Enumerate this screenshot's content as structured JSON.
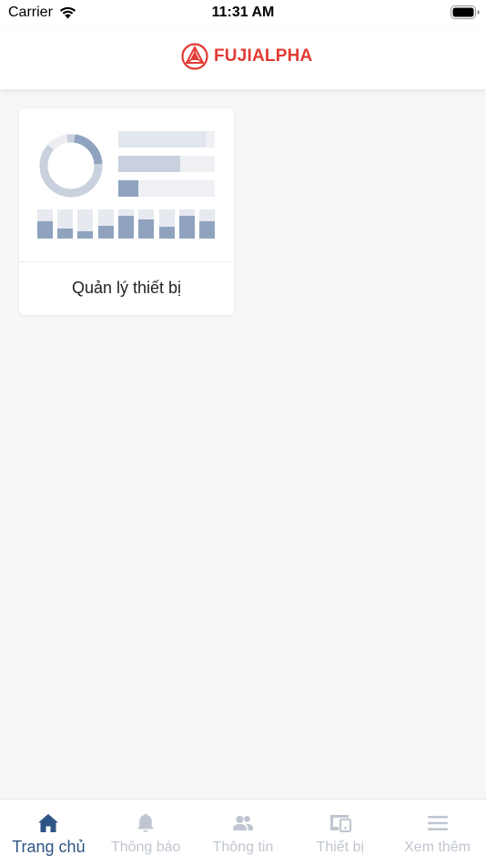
{
  "status_bar": {
    "carrier": "Carrier",
    "time": "11:31 AM"
  },
  "header": {
    "logo_text": "FUJIALPHA",
    "brand_color": "#e23b33"
  },
  "home": {
    "cards": [
      {
        "label": "Quản lý thiết bị",
        "icon": "device-management-illustration"
      }
    ]
  },
  "tab_bar": {
    "active_color": "#2f5586",
    "inactive_color": "#c0c6d1",
    "tabs": [
      {
        "label": "Trang chủ",
        "icon": "home-icon",
        "active": true
      },
      {
        "label": "Thông báo",
        "icon": "bell-icon",
        "active": false
      },
      {
        "label": "Thông tin",
        "icon": "people-icon",
        "active": false
      },
      {
        "label": "Thiết bị",
        "icon": "devices-icon",
        "active": false
      },
      {
        "label": "Xem thêm",
        "icon": "menu-icon",
        "active": false
      }
    ]
  }
}
